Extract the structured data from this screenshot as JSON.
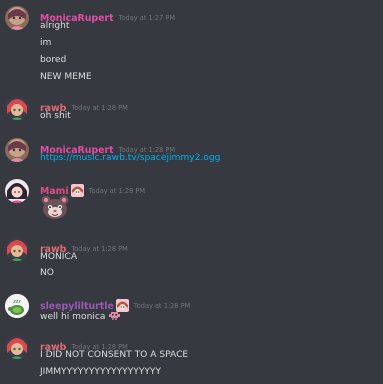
{
  "colors": {
    "background": "#36393f",
    "monica": "#e44ba4",
    "rawb": "#e06c75",
    "mami": "#e44b8c",
    "sleepy": "#9b59b6",
    "link": "#00b0f4",
    "timestamp": "#72767d",
    "text": "#dcddde"
  },
  "messages": [
    {
      "author": "MonicaRupert",
      "timestamp": "Today at 1:27 PM",
      "lines": [
        "alright",
        "im",
        "bored",
        "NEW MEME"
      ]
    },
    {
      "author": "rawb",
      "timestamp": "Today at 1:28 PM",
      "lines": [
        "oh shit"
      ]
    },
    {
      "author": "MonicaRupert",
      "timestamp": "Today at 1:28 PM",
      "lines": [
        "https://music.rawb.tv/spacejimmy2.ogg"
      ]
    },
    {
      "author": "Mami",
      "timestamp": "Today at 1:28 PM",
      "badge": "anime-girl-emoji",
      "emoji": "cat-face-emoji"
    },
    {
      "author": "rawb",
      "timestamp": "Today at 1:28 PM",
      "lines": [
        "MONICA",
        "NO"
      ]
    },
    {
      "author": "sleepylilturtle",
      "timestamp": "Today at 1:28 PM",
      "badge": "anime-girl-emoji",
      "lines": [
        "well hi monica"
      ],
      "inline_emoji": "pixel-creature-emoji"
    },
    {
      "author": "rawb",
      "timestamp": "Today at 1:28 PM",
      "lines": [
        "I DID NOT CONSENT TO A SPACE",
        "JIMMYYYYYYYYYYYYYYYYYY"
      ]
    }
  ]
}
